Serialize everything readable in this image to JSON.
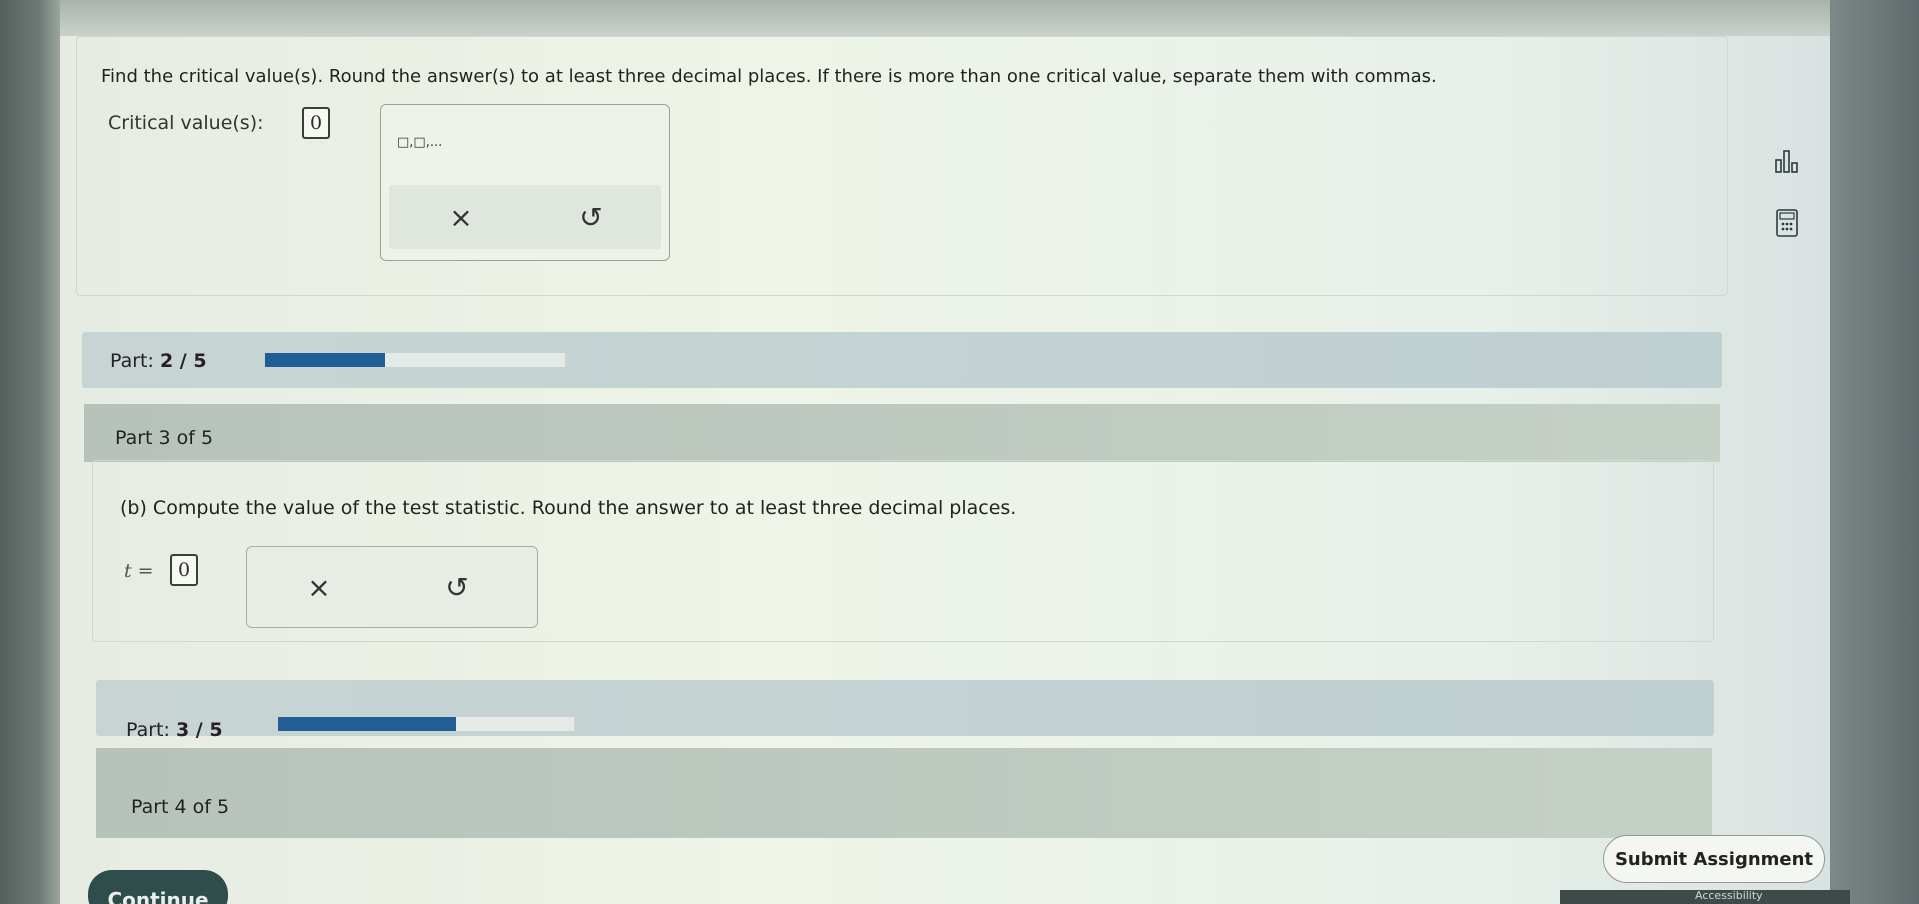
{
  "question": {
    "instruction": "Find the critical value(s). Round the answer(s) to at least three decimal places. If there is more than one critical value, separate them with commas.",
    "critical_label": "Critical value(s):",
    "critical_value": "0",
    "popup_hint": "□,□,...",
    "clear_icon": "×",
    "undo_icon": "↺"
  },
  "side_tools": {
    "chart_icon": "▯▮▯",
    "calculator_icon": "▦"
  },
  "progress_1": {
    "prefix": "Part:",
    "value": "2 / 5",
    "fill_fraction": 0.4
  },
  "part3": {
    "title": "Part 3 of 5",
    "prompt": "(b) Compute the value of the test statistic. Round the answer to at least three decimal places.",
    "t_label": "t =",
    "t_value": "0",
    "clear_icon": "×",
    "undo_icon": "↺"
  },
  "progress_2": {
    "prefix": "Part:",
    "value": "3 / 5",
    "fill_fraction": 0.6
  },
  "part4": {
    "title": "Part 4 of 5"
  },
  "buttons": {
    "submit": "Submit Assignment",
    "continue": "Continue"
  },
  "footer": {
    "link": "Accessibility"
  }
}
